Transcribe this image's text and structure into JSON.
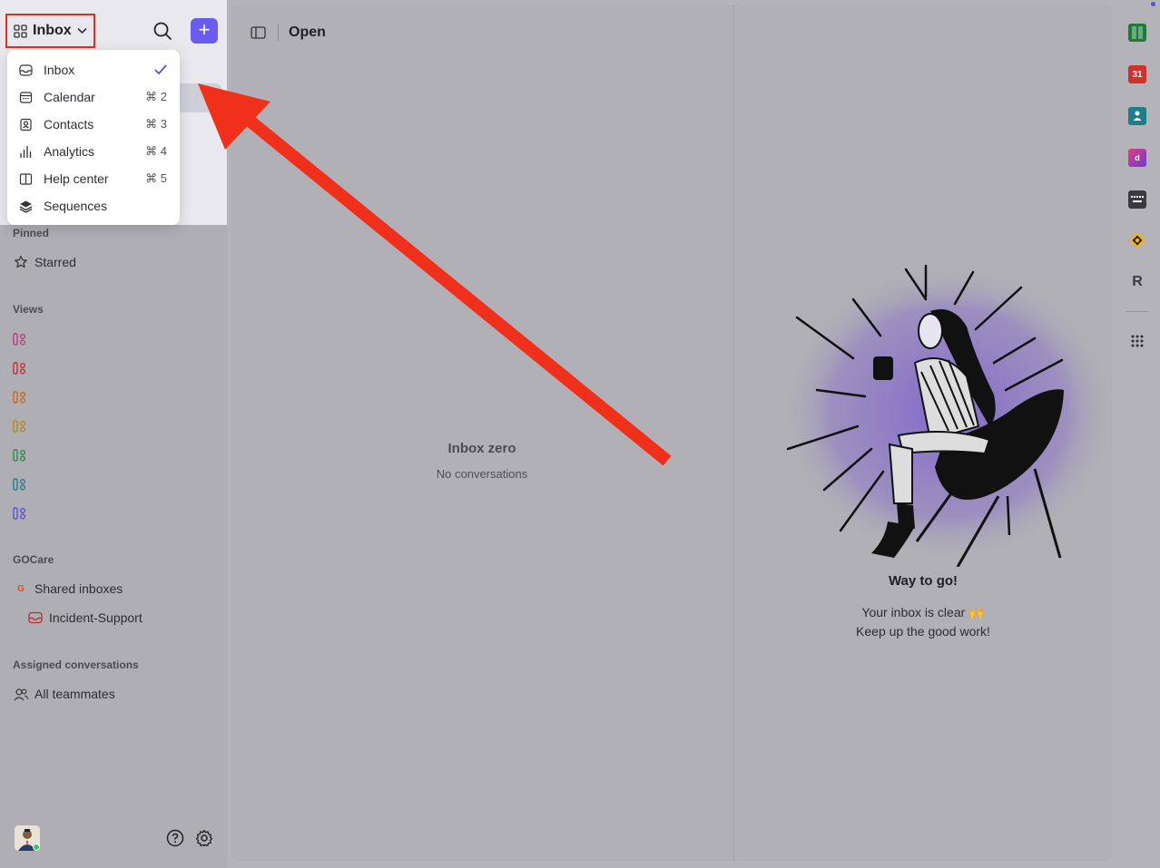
{
  "sidebar": {
    "switcher_label": "Inbox",
    "dropdown": [
      {
        "label": "Inbox",
        "shortcut": "",
        "checked": true,
        "icon": "inbox-icon"
      },
      {
        "label": "Calendar",
        "shortcut": "⌘ 2",
        "icon": "calendar-icon"
      },
      {
        "label": "Contacts",
        "shortcut": "⌘ 3",
        "icon": "contacts-icon"
      },
      {
        "label": "Analytics",
        "shortcut": "⌘ 4",
        "icon": "analytics-icon"
      },
      {
        "label": "Help center",
        "shortcut": "⌘ 5",
        "icon": "book-icon"
      },
      {
        "label": "Sequences",
        "shortcut": "",
        "icon": "layers-icon"
      }
    ],
    "pinned_title": "Pinned",
    "starred_label": "Starred",
    "views_title": "Views",
    "view_colors": [
      "#c2387e",
      "#c72e2e",
      "#d0651f",
      "#b58a12",
      "#2e8a4a",
      "#1f7f8e",
      "#5a50d8"
    ],
    "gocare_title": "GOCare",
    "shared_inboxes_label": "Shared inboxes",
    "incident_label": "Incident-Support",
    "assigned_title": "Assigned conversations",
    "all_teammates_label": "All teammates"
  },
  "main": {
    "title": "Open",
    "empty_title": "Inbox zero",
    "empty_sub": "No conversations",
    "way_title": "Way to go!",
    "way_sub1": "Your inbox is clear 🙌",
    "way_sub2": "Keep up the good work!"
  },
  "rail": {
    "calendar_day": "31",
    "r_label": "R"
  },
  "colors": {
    "accent": "#6a5cf0",
    "highlight_box": "#e0301e",
    "arrow": "#f0301a"
  }
}
